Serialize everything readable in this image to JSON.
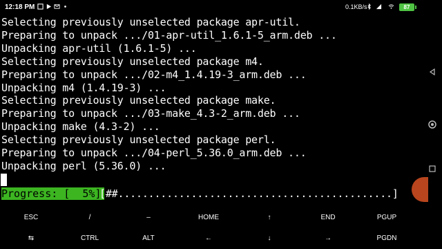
{
  "status": {
    "time": "12:18 PM",
    "speed": "0.1KB/s",
    "battery": "87"
  },
  "terminal": {
    "lines": [
      "Selecting previously unselected package apr-util.",
      "Preparing to unpack .../01-apr-util_1.6.1-5_arm.deb ...",
      "Unpacking apr-util (1.6.1-5) ...",
      "Selecting previously unselected package m4.",
      "Preparing to unpack .../02-m4_1.4.19-3_arm.deb ...",
      "Unpacking m4 (1.4.19-3) ...",
      "Selecting previously unselected package make.",
      "Preparing to unpack .../03-make_4.3-2_arm.deb ...",
      "Unpacking make (4.3-2) ...",
      "Selecting previously unselected package perl.",
      "Preparing to unpack .../04-perl_5.36.0_arm.deb ...",
      "Unpacking perl (5.36.0) ..."
    ],
    "progress_label": "Progress: [  5%]",
    "progress_bar": "[##.............................................]",
    "progress_value": 5
  },
  "extra_keys": {
    "row1": [
      "ESC",
      "/",
      "–",
      "HOME",
      "↑",
      "END",
      "PGUP"
    ],
    "row2": [
      "⇆",
      "CTRL",
      "ALT",
      "←",
      "↓",
      "→",
      "PGDN"
    ]
  },
  "colors": {
    "progress_bg": "#3cb521",
    "battery": "#4fc343",
    "handle": "#b8451e"
  }
}
